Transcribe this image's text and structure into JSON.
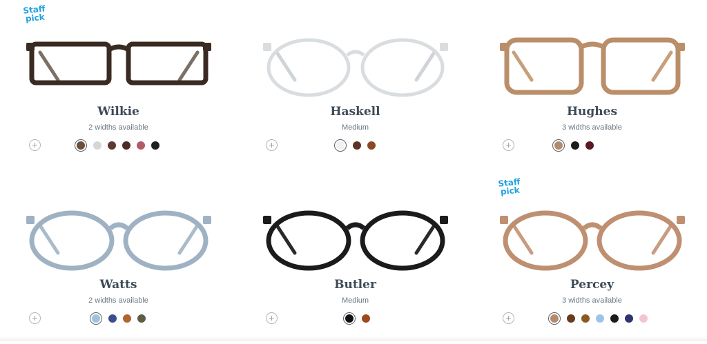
{
  "products": [
    {
      "name": "Wilkie",
      "sub": "2 widths available",
      "staff_pick": "Staff\npick",
      "frame": {
        "type": "rect",
        "stroke": "#3b2a22",
        "temple": "#7c6f66",
        "lens_fill": "none",
        "light": false
      },
      "swatches": [
        {
          "color": "#6b4f3a",
          "selected": true
        },
        {
          "color": "#d6d6d6"
        },
        {
          "color": "#5a3a32"
        },
        {
          "color": "#4a2b25"
        },
        {
          "color": "#b35a6a"
        },
        {
          "color": "#1f1f22"
        }
      ]
    },
    {
      "name": "Haskell",
      "sub": "Medium",
      "staff_pick": "",
      "frame": {
        "type": "round",
        "stroke": "#d9dde0",
        "temple": "#cfd4d8",
        "lens_fill": "none",
        "light": true
      },
      "swatches": [
        {
          "color": "#f1f1f1",
          "selected": true
        },
        {
          "color": "#5a3526"
        },
        {
          "color": "#8a4a25"
        }
      ]
    },
    {
      "name": "Hughes",
      "sub": "3 widths available",
      "staff_pick": "",
      "frame": {
        "type": "square",
        "stroke": "#b98e69",
        "temple": "#c79f7b",
        "lens_fill": "none",
        "light": false
      },
      "swatches": [
        {
          "color": "#b58b6c",
          "selected": true
        },
        {
          "color": "#1c1c1e"
        },
        {
          "color": "#5a1820"
        }
      ]
    },
    {
      "name": "Watts",
      "sub": "2 widths available",
      "staff_pick": "",
      "frame": {
        "type": "round",
        "stroke": "#9fb2c4",
        "temple": "#a9bccb",
        "lens_fill": "none",
        "light": false
      },
      "swatches": [
        {
          "color": "#9ec3dd",
          "selected": true
        },
        {
          "color": "#3c4e8a"
        },
        {
          "color": "#b0652e"
        },
        {
          "color": "#5f5b45"
        }
      ]
    },
    {
      "name": "Butler",
      "sub": "Medium",
      "staff_pick": "",
      "frame": {
        "type": "round",
        "stroke": "#1b1b1d",
        "temple": "#2a2a2c",
        "lens_fill": "none",
        "light": false
      },
      "swatches": [
        {
          "color": "#111113",
          "selected": true
        },
        {
          "color": "#9c4a1c"
        }
      ]
    },
    {
      "name": "Percey",
      "sub": "3 widths available",
      "staff_pick": "Staff\npick",
      "frame": {
        "type": "round",
        "stroke": "#bf8f71",
        "temple": "#c89c80",
        "lens_fill": "none",
        "light": false
      },
      "swatches": [
        {
          "color": "#b58b6c",
          "selected": true
        },
        {
          "color": "#6a3a1e"
        },
        {
          "color": "#8a5a22"
        },
        {
          "color": "#9ec3e8"
        },
        {
          "color": "#1c1c1e"
        },
        {
          "color": "#2e3470"
        },
        {
          "color": "#f3c6cf"
        }
      ]
    }
  ],
  "add_label": "+"
}
